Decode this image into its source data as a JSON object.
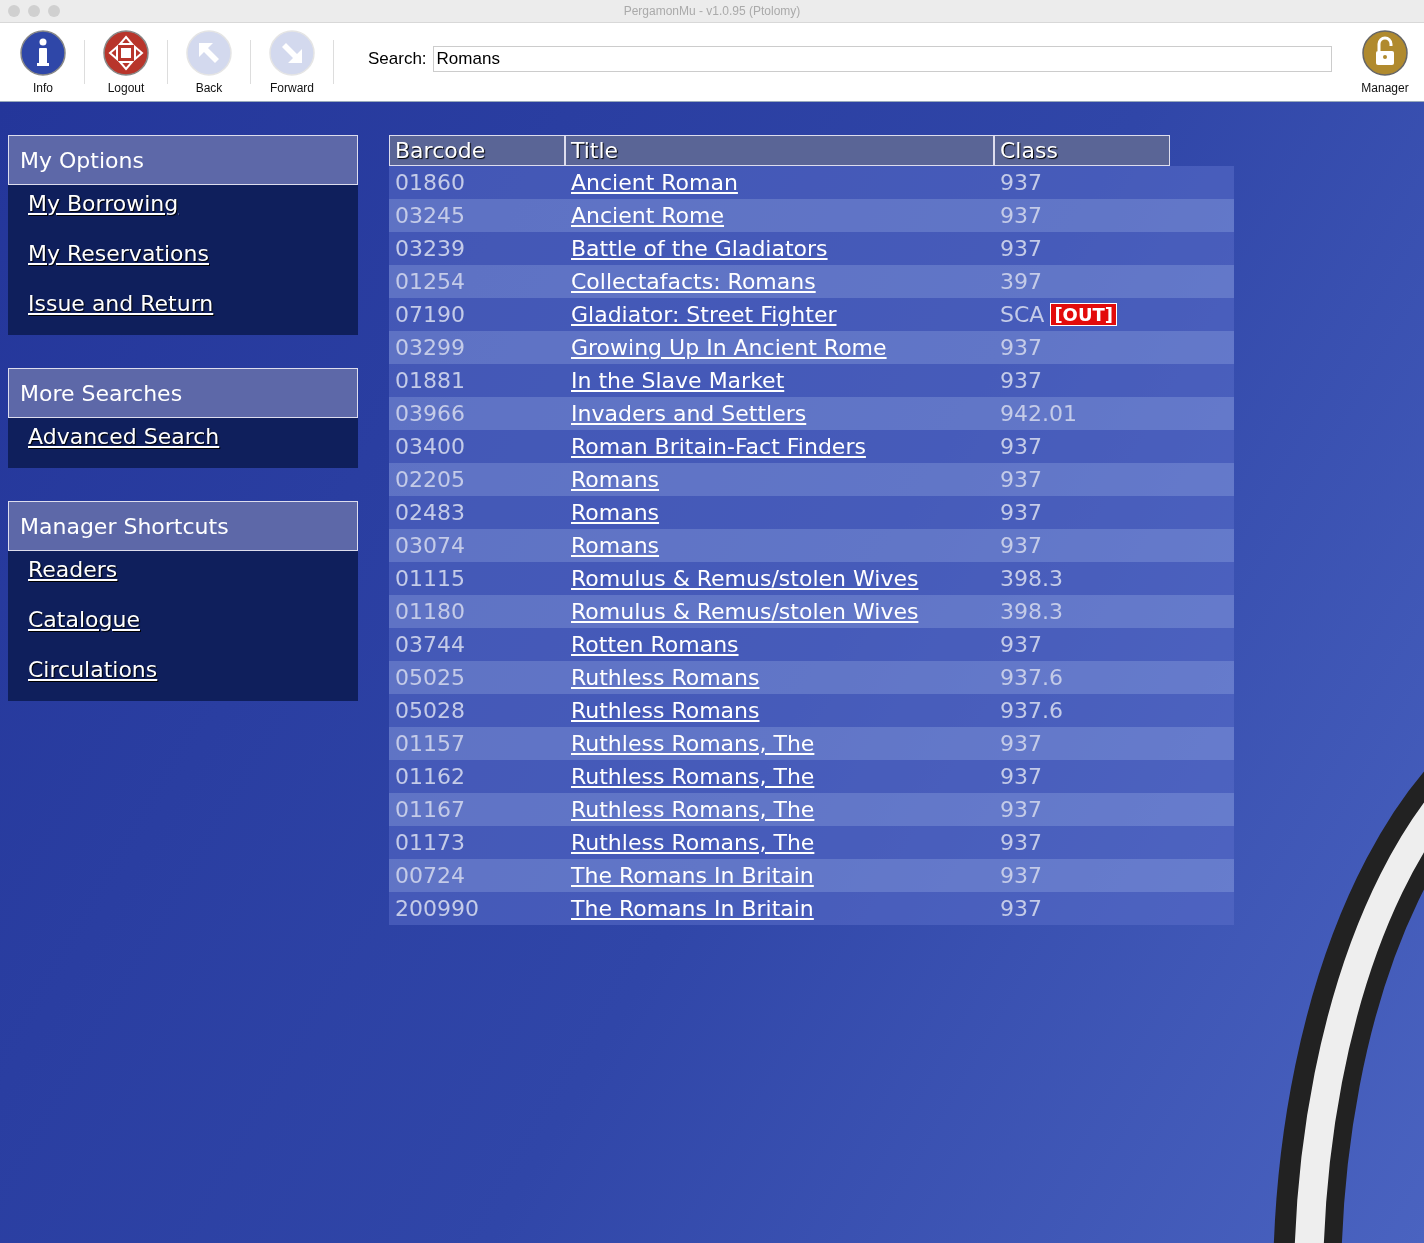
{
  "window": {
    "title": "PergamonMu - v1.0.95 (Ptolomy)"
  },
  "toolbar": {
    "buttons": [
      {
        "label": "Info",
        "kind": "info",
        "disabled": false
      },
      {
        "label": "Logout",
        "kind": "logout",
        "disabled": false
      },
      {
        "label": "Back",
        "kind": "back",
        "disabled": true
      },
      {
        "label": "Forward",
        "kind": "forward",
        "disabled": true
      }
    ],
    "search": {
      "label": "Search:",
      "value": "Romans"
    },
    "manager": {
      "label": "Manager",
      "kind": "lock"
    }
  },
  "sidebar": [
    {
      "title": "My Options",
      "links": [
        "My Borrowing",
        "My Reservations",
        "Issue and Return"
      ]
    },
    {
      "title": "More Searches",
      "links": [
        "Advanced Search"
      ]
    },
    {
      "title": "Manager Shortcuts",
      "links": [
        "Readers",
        "Catalogue",
        "Circulations"
      ]
    }
  ],
  "table": {
    "columns": [
      "Barcode",
      "Title",
      "Class"
    ],
    "rows": [
      {
        "barcode": "01860",
        "title": "Ancient Roman",
        "class": "937"
      },
      {
        "barcode": "03245",
        "title": "Ancient Rome",
        "class": "937"
      },
      {
        "barcode": "03239",
        "title": "Battle of the Gladiators",
        "class": "937"
      },
      {
        "barcode": "01254",
        "title": "Collectafacts: Romans",
        "class": "397"
      },
      {
        "barcode": "07190",
        "title": "Gladiator: Street Fighter",
        "class": "SCA",
        "status": "[OUT]"
      },
      {
        "barcode": "03299",
        "title": "Growing Up In Ancient Rome",
        "class": "937"
      },
      {
        "barcode": "01881",
        "title": "In the Slave Market",
        "class": "937"
      },
      {
        "barcode": "03966",
        "title": "Invaders and Settlers",
        "class": "942.01"
      },
      {
        "barcode": "03400",
        "title": "Roman Britain-Fact Finders",
        "class": "937"
      },
      {
        "barcode": "02205",
        "title": "Romans",
        "class": "937"
      },
      {
        "barcode": "02483",
        "title": "Romans",
        "class": "937"
      },
      {
        "barcode": "03074",
        "title": "Romans",
        "class": "937"
      },
      {
        "barcode": "01115",
        "title": "Romulus & Remus/stolen Wives",
        "class": "398.3"
      },
      {
        "barcode": "01180",
        "title": "Romulus & Remus/stolen Wives",
        "class": "398.3"
      },
      {
        "barcode": "03744",
        "title": "Rotten Romans",
        "class": "937"
      },
      {
        "barcode": "05025",
        "title": "Ruthless Romans",
        "class": "937.6"
      },
      {
        "barcode": "05028",
        "title": "Ruthless Romans",
        "class": "937.6"
      },
      {
        "barcode": "01157",
        "title": "Ruthless Romans, The",
        "class": "937"
      },
      {
        "barcode": "01162",
        "title": "Ruthless Romans, The",
        "class": "937"
      },
      {
        "barcode": "01167",
        "title": "Ruthless Romans, The",
        "class": "937"
      },
      {
        "barcode": "01173",
        "title": "Ruthless Romans, The",
        "class": "937"
      },
      {
        "barcode": "00724",
        "title": "The Romans In Britain",
        "class": "937"
      },
      {
        "barcode": "200990",
        "title": "The Romans In Britain",
        "class": "937"
      }
    ]
  }
}
